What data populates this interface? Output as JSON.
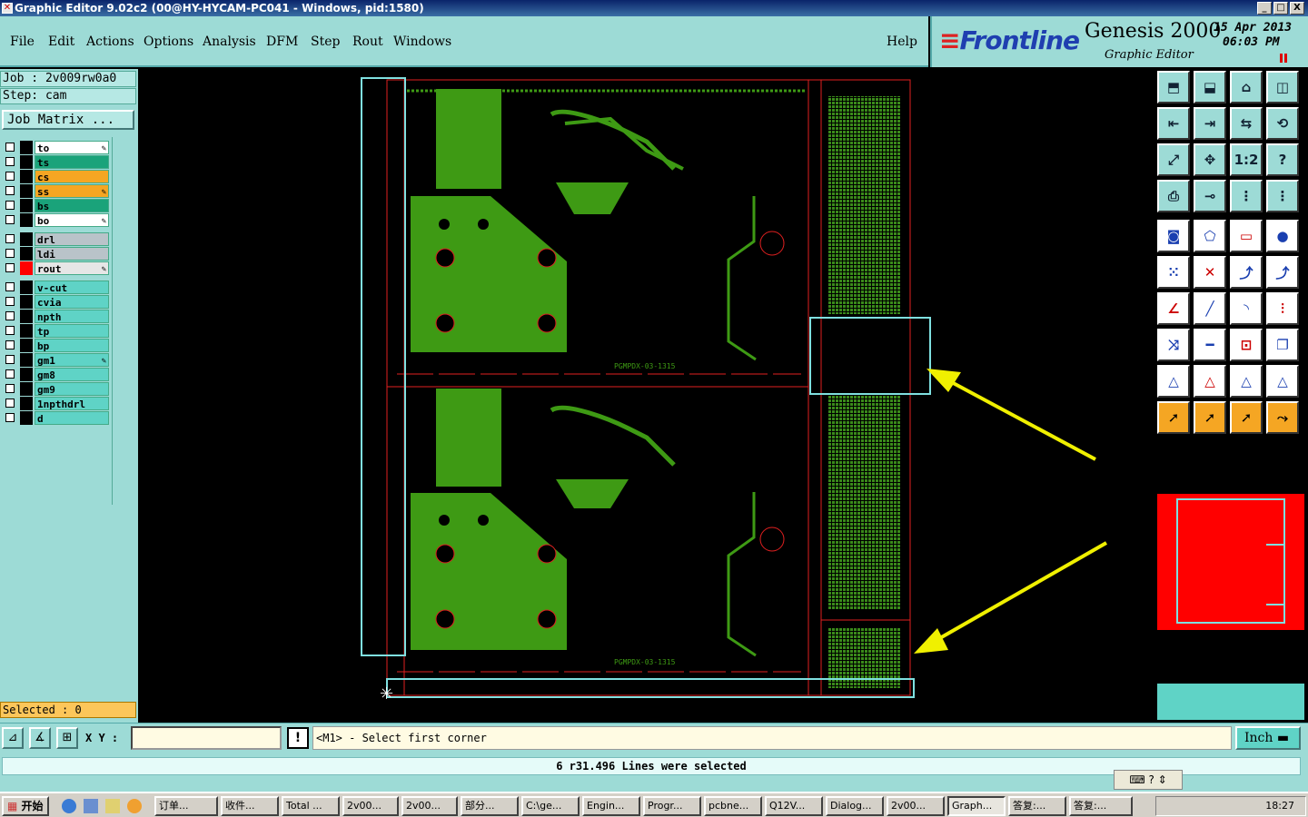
{
  "window": {
    "title": "Graphic Editor 9.02c2 (00@HY-HYCAM-PC041 - Windows, pid:1580)",
    "controls": [
      "_",
      "□",
      "X"
    ]
  },
  "menu": {
    "items": [
      "File",
      "Edit",
      "Actions",
      "Options",
      "Analysis",
      "DFM",
      "Step",
      "Rout",
      "Windows"
    ],
    "help": "Help"
  },
  "brand": {
    "logo": "Frontline",
    "product": "Genesis 2000",
    "subtitle": "Graphic Editor",
    "date": "15 Apr 2013",
    "time": "06:03 PM"
  },
  "job": {
    "job_line": "Job : 2v009rw0a0",
    "step_line": "Step: cam",
    "matrix_button": "Job Matrix ..."
  },
  "layers": [
    {
      "name": "to",
      "color": "#ffffff",
      "swatch": "#000000",
      "edit": true
    },
    {
      "name": "ts",
      "color": "#1aa37a",
      "swatch": "#000000",
      "edit": false
    },
    {
      "name": "cs",
      "color": "#f5a623",
      "swatch": "#000000",
      "edit": false
    },
    {
      "name": "ss",
      "color": "#f5a623",
      "swatch": "#000000",
      "edit": true
    },
    {
      "name": "bs",
      "color": "#1aa37a",
      "swatch": "#000000",
      "edit": false
    },
    {
      "name": "bo",
      "color": "#ffffff",
      "swatch": "#000000",
      "edit": true
    },
    {
      "name": "drl",
      "color": "#b9c3c9",
      "swatch": "#000000",
      "edit": false
    },
    {
      "name": "ldi",
      "color": "#b9c3c9",
      "swatch": "#000000",
      "edit": false
    },
    {
      "name": "rout",
      "color": "#e6e6e6",
      "swatch": "#ff0000",
      "edit": true
    },
    {
      "name": "v-cut",
      "color": "#5fd3c6",
      "swatch": "#000000",
      "edit": false
    },
    {
      "name": "cvia",
      "color": "#5fd3c6",
      "swatch": "#000000",
      "edit": false
    },
    {
      "name": "npth",
      "color": "#5fd3c6",
      "swatch": "#000000",
      "edit": false
    },
    {
      "name": "tp",
      "color": "#5fd3c6",
      "swatch": "#000000",
      "edit": false
    },
    {
      "name": "bp",
      "color": "#5fd3c6",
      "swatch": "#000000",
      "edit": false
    },
    {
      "name": "gm1",
      "color": "#5fd3c6",
      "swatch": "#000000",
      "edit": true
    },
    {
      "name": "gm8",
      "color": "#5fd3c6",
      "swatch": "#000000",
      "edit": false
    },
    {
      "name": "gm9",
      "color": "#5fd3c6",
      "swatch": "#000000",
      "edit": false
    },
    {
      "name": "1npthdrl",
      "color": "#5fd3c6",
      "swatch": "#000000",
      "edit": false
    },
    {
      "name": "d",
      "color": "#5fd3c6",
      "swatch": "#000000",
      "edit": false
    }
  ],
  "selected": "Selected : 0",
  "board": {
    "label_top": "PGMPDX-03-1315",
    "label_bottom": "PGMPDX-03-1315"
  },
  "toolbar_icons": [
    "fit-icon",
    "zoom-home-icon",
    "home-icon",
    "split-view-icon",
    "pan-left-icon",
    "pan-right-icon",
    "swap-icon",
    "redraw-icon",
    "zoom-fit-icon",
    "zoom-center-icon",
    "scale-1-2-icon",
    "query-icon",
    "measure-icon",
    "snap-icon",
    "net-query-icon",
    "net-highlight-icon",
    "film-icon",
    "window-icon",
    "ruler-icon",
    "pad-icon",
    "nodes-icon",
    "cross-icon",
    "line-add-icon",
    "line-add2-icon",
    "angle-icon",
    "slash-icon",
    "arc-icon",
    "mirror-icon",
    "move-icon",
    "minus-icon",
    "resize-icon",
    "copy-icon",
    "triangle-icon",
    "triangle-a-icon",
    "triangle-b-icon",
    "triangle-c-icon",
    "select-icon",
    "select-box-icon",
    "select-touch-icon",
    "select-net-icon"
  ],
  "toolbar_labels": [
    "1:2",
    "?"
  ],
  "command": {
    "xy_label": "X Y :",
    "xy_value": "",
    "prompt": "<M1> - Select first corner",
    "units": "Inch"
  },
  "status": "6 r31.496 Lines were selected",
  "taskbar": {
    "start": "开始",
    "tasks": [
      "订单...",
      "收件...",
      "Total ...",
      "2v00...",
      "2v00...",
      "部分...",
      "C:\\ge...",
      "Engin...",
      "Progr...",
      "pcbne...",
      "Q12V...",
      "Dialog...",
      "2v00...",
      "Graph...",
      "答复:...",
      "答复:..."
    ],
    "active_index": 13,
    "clock": "18:27"
  }
}
